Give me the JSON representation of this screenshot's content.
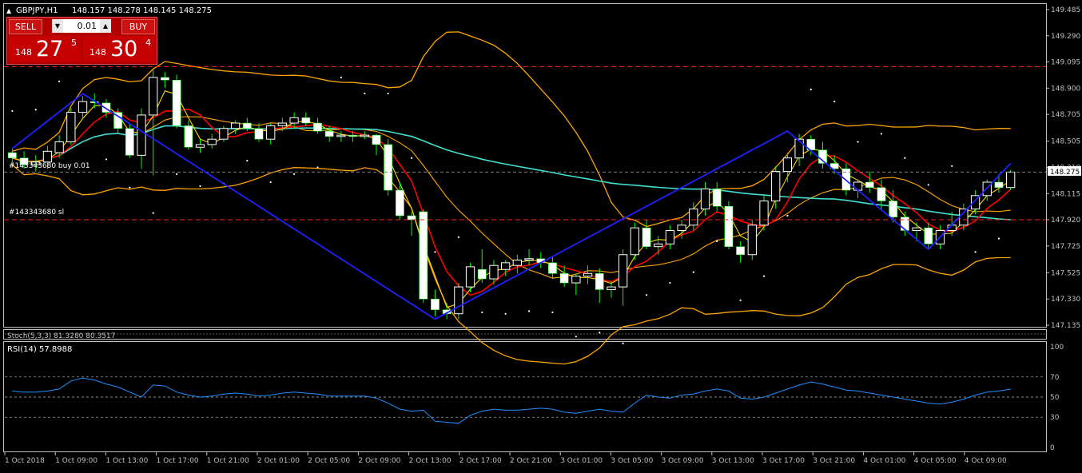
{
  "window": {
    "symbol_title": "GBPJPY,H1",
    "ohlc": "148.157 148.278 148.145 148.275"
  },
  "trade_panel": {
    "sell_label": "SELL",
    "buy_label": "BUY",
    "lot": "0.01",
    "sell_price": {
      "prefix": "148",
      "big": "27",
      "sup": "5"
    },
    "buy_price": {
      "prefix": "148",
      "big": "30",
      "sup": "4"
    }
  },
  "order_lines": [
    {
      "label": "#143343680 buy 0.01",
      "price": 148.275,
      "color": "#808080"
    },
    {
      "label": "#143343680 sl",
      "price": 147.92,
      "color": "#ff2020"
    }
  ],
  "price_levels": {
    "current": 148.275,
    "red_dashed_top": 149.06
  },
  "stoch_label": "Stoch(5,3,3) 81.3280 80.3517",
  "rsi_label": "RSI(14) 57.8988",
  "colors": {
    "bull": "#ffffff",
    "bear": "#ffffff",
    "wick": "#00ff00",
    "bollinger": "#ffa500",
    "ma_fast": "#ff0000",
    "ma_mid": "#ffd700",
    "ma_slow": "#40e0d0",
    "zigzag": "#2020ff",
    "psar": "#ffffff",
    "rsi": "#1e90ff",
    "axis": "#c0c0c0",
    "current_price_bg": "#ffffff"
  },
  "chart_data": [
    {
      "type": "candlestick",
      "y_ticks": [
        "149.485",
        "149.290",
        "149.095",
        "148.900",
        "148.705",
        "148.505",
        "148.310",
        "148.115",
        "147.920",
        "147.725",
        "147.525",
        "147.330",
        "147.135"
      ],
      "x_ticks": [
        "1 Oct 2018",
        "1 Oct 09:00",
        "1 Oct 13:00",
        "1 Oct 17:00",
        "1 Oct 21:00",
        "2 Oct 01:00",
        "2 Oct 05:00",
        "2 Oct 09:00",
        "2 Oct 13:00",
        "2 Oct 17:00",
        "2 Oct 21:00",
        "3 Oct 01:00",
        "3 Oct 05:00",
        "3 Oct 09:00",
        "3 Oct 13:00",
        "3 Oct 17:00",
        "3 Oct 21:00",
        "4 Oct 01:00",
        "4 Oct 05:00",
        "4 Oct 09:00"
      ],
      "ylim": [
        147.135,
        149.485
      ],
      "ohlc": [
        [
          148.42,
          148.45,
          148.33,
          148.38
        ],
        [
          148.38,
          148.43,
          148.3,
          148.33
        ],
        [
          148.33,
          148.4,
          148.28,
          148.35
        ],
        [
          148.35,
          148.47,
          148.3,
          148.43
        ],
        [
          148.42,
          148.55,
          148.38,
          148.5
        ],
        [
          148.5,
          148.75,
          148.48,
          148.72
        ],
        [
          148.72,
          148.84,
          148.68,
          148.8
        ],
        [
          148.8,
          148.86,
          148.75,
          148.79
        ],
        [
          148.79,
          148.82,
          148.68,
          148.72
        ],
        [
          148.72,
          148.75,
          148.56,
          148.6
        ],
        [
          148.6,
          148.64,
          148.38,
          148.4
        ],
        [
          148.4,
          148.75,
          148.3,
          148.7
        ],
        [
          148.7,
          149.04,
          148.25,
          148.98
        ],
        [
          148.98,
          149.02,
          148.9,
          148.96
        ],
        [
          148.96,
          149.0,
          148.6,
          148.62
        ],
        [
          148.62,
          148.66,
          148.44,
          148.46
        ],
        [
          148.46,
          148.52,
          148.42,
          148.48
        ],
        [
          148.48,
          148.56,
          148.45,
          148.52
        ],
        [
          148.52,
          148.62,
          148.5,
          148.6
        ],
        [
          148.6,
          148.66,
          148.56,
          148.64
        ],
        [
          148.64,
          148.68,
          148.58,
          148.6
        ],
        [
          148.6,
          148.64,
          148.5,
          148.52
        ],
        [
          148.52,
          148.64,
          148.48,
          148.62
        ],
        [
          148.62,
          148.68,
          148.58,
          148.64
        ],
        [
          148.64,
          148.72,
          148.6,
          148.68
        ],
        [
          148.68,
          148.72,
          148.62,
          148.64
        ],
        [
          148.64,
          148.68,
          148.56,
          148.58
        ],
        [
          148.58,
          148.62,
          148.5,
          148.54
        ],
        [
          148.54,
          148.58,
          148.5,
          148.55
        ],
        [
          148.55,
          148.58,
          148.5,
          148.54
        ],
        [
          148.54,
          148.58,
          148.52,
          148.55
        ],
        [
          148.55,
          148.56,
          148.4,
          148.48
        ],
        [
          148.48,
          148.52,
          148.1,
          148.14
        ],
        [
          148.14,
          148.2,
          147.92,
          147.95
        ],
        [
          147.95,
          147.98,
          147.8,
          147.92
        ],
        [
          147.98,
          148.0,
          147.3,
          147.33
        ],
        [
          147.33,
          147.4,
          147.2,
          147.25
        ],
        [
          147.25,
          147.3,
          147.18,
          147.22
        ],
        [
          147.22,
          147.45,
          147.18,
          147.42
        ],
        [
          147.42,
          147.6,
          147.38,
          147.57
        ],
        [
          147.55,
          147.7,
          147.45,
          147.48
        ],
        [
          147.48,
          147.62,
          147.44,
          147.58
        ],
        [
          147.55,
          147.62,
          147.5,
          147.6
        ],
        [
          147.58,
          147.66,
          147.52,
          147.62
        ],
        [
          147.62,
          147.7,
          147.58,
          147.63
        ],
        [
          147.63,
          147.68,
          147.56,
          147.6
        ],
        [
          147.6,
          147.64,
          147.48,
          147.52
        ],
        [
          147.52,
          147.58,
          147.42,
          147.45
        ],
        [
          147.45,
          147.52,
          147.36,
          147.5
        ],
        [
          147.5,
          147.58,
          147.44,
          147.52
        ],
        [
          147.52,
          147.56,
          147.3,
          147.4
        ],
        [
          147.4,
          147.46,
          147.34,
          147.42
        ],
        [
          147.42,
          147.7,
          147.28,
          147.66
        ],
        [
          147.66,
          147.9,
          147.62,
          147.86
        ],
        [
          147.86,
          147.92,
          147.7,
          147.72
        ],
        [
          147.72,
          147.8,
          147.66,
          147.74
        ],
        [
          147.74,
          147.88,
          147.7,
          147.84
        ],
        [
          147.84,
          147.92,
          147.78,
          147.88
        ],
        [
          147.88,
          148.05,
          147.84,
          148.0
        ],
        [
          148.0,
          148.2,
          147.95,
          148.15
        ],
        [
          148.15,
          148.2,
          147.98,
          148.02
        ],
        [
          148.02,
          148.06,
          147.7,
          147.72
        ],
        [
          147.72,
          147.76,
          147.6,
          147.66
        ],
        [
          147.66,
          147.92,
          147.62,
          147.88
        ],
        [
          147.88,
          148.1,
          147.84,
          148.06
        ],
        [
          148.06,
          148.32,
          148.0,
          148.28
        ],
        [
          148.28,
          148.42,
          148.2,
          148.38
        ],
        [
          148.38,
          148.56,
          148.32,
          148.52
        ],
        [
          148.52,
          148.55,
          148.4,
          148.44
        ],
        [
          148.44,
          148.5,
          148.3,
          148.34
        ],
        [
          148.34,
          148.4,
          148.26,
          148.3
        ],
        [
          148.3,
          148.34,
          148.1,
          148.14
        ],
        [
          148.14,
          148.22,
          148.08,
          148.2
        ],
        [
          148.2,
          148.28,
          148.12,
          148.16
        ],
        [
          148.16,
          148.22,
          148.0,
          148.06
        ],
        [
          148.06,
          148.14,
          147.9,
          147.94
        ],
        [
          147.94,
          147.98,
          147.8,
          147.84
        ],
        [
          147.84,
          147.9,
          147.76,
          147.86
        ],
        [
          147.86,
          147.9,
          147.7,
          147.74
        ],
        [
          147.74,
          147.88,
          147.7,
          147.84
        ],
        [
          147.84,
          147.98,
          147.8,
          147.88
        ],
        [
          147.88,
          148.04,
          147.84,
          148.0
        ],
        [
          148.0,
          148.14,
          147.96,
          148.1
        ],
        [
          148.1,
          148.22,
          148.06,
          148.2
        ],
        [
          148.2,
          148.26,
          148.12,
          148.16
        ],
        [
          148.16,
          148.29,
          148.14,
          148.275
        ]
      ],
      "rsi": [
        56,
        55,
        55,
        56,
        58,
        66,
        69,
        67,
        63,
        60,
        55,
        50,
        62,
        61,
        55,
        52,
        50,
        51,
        53,
        54,
        53,
        51,
        52,
        54,
        55,
        54,
        53,
        51,
        51,
        51,
        51,
        49,
        44,
        38,
        36,
        37,
        26,
        25,
        24,
        32,
        36,
        38,
        37,
        37,
        38,
        39,
        38,
        35,
        34,
        36,
        38,
        36,
        35,
        44,
        52,
        50,
        49,
        52,
        53,
        56,
        58,
        56,
        49,
        48,
        50,
        54,
        58,
        62,
        65,
        63,
        60,
        57,
        56,
        54,
        52,
        50,
        48,
        46,
        44,
        43,
        45,
        48,
        52,
        55,
        56,
        57.9
      ],
      "rsi_ylim": [
        0,
        100
      ],
      "rsi_ticks": [
        "100",
        "70",
        "50",
        "30",
        "0"
      ]
    }
  ]
}
